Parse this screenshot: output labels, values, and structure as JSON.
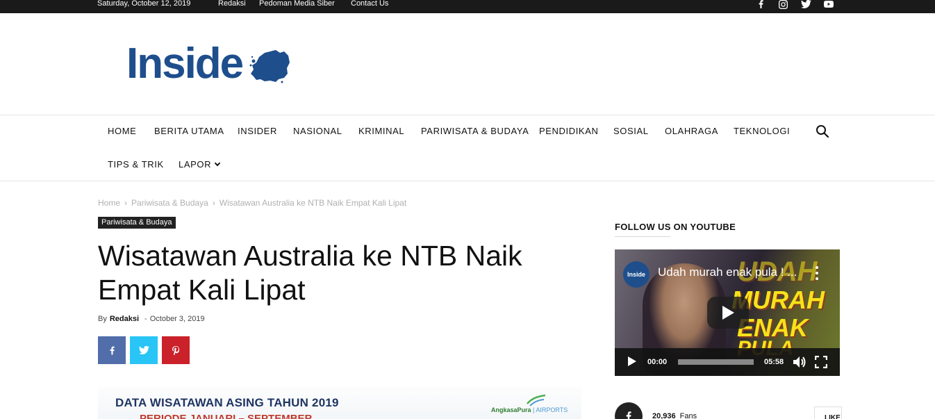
{
  "topbar": {
    "date": "Saturday, October 12, 2019",
    "links": [
      "Redaksi",
      "Pedoman Media Siber",
      "Contact Us"
    ],
    "social_icons": [
      "facebook-icon",
      "instagram-icon",
      "twitter-icon",
      "youtube-icon"
    ]
  },
  "header": {
    "logo_text": "Inside",
    "logo_color": "#1e4e8c"
  },
  "nav": {
    "items": [
      "HOME",
      "BERITA UTAMA",
      "INSIDER",
      "NASIONAL",
      "KRIMINAL",
      "PARIWISATA & BUDAYA",
      "PENDIDIKAN",
      "SOSIAL",
      "OLAHRAGA",
      "TEKNOLOGI",
      "TIPS & TRIK",
      "LAPOR"
    ],
    "search_icon": "search-icon"
  },
  "breadcrumb": {
    "items": [
      "Home",
      "Pariwisata & Budaya",
      "Wisatawan Australia ke NTB Naik Empat Kali Lipat"
    ],
    "separator": "›"
  },
  "article": {
    "category": "Pariwisata & Budaya",
    "title": "Wisatawan Australia ke NTB Naik Empat Kali Lipat",
    "by": "By",
    "author": "Redaksi",
    "dash": "-",
    "date": "October 3, 2019",
    "share": [
      {
        "icon": "facebook-icon",
        "color": "#516eab"
      },
      {
        "icon": "twitter-icon",
        "color": "#29c5f6"
      },
      {
        "icon": "pinterest-icon",
        "color": "#ca212a"
      }
    ],
    "image": {
      "title": "DATA WISATAWAN ASING TAHUN 2019",
      "subtitle": "PERIODE JANUARI – SEPTEMBER",
      "brand": "AngkasaPura",
      "brand_suffix": "| AIRPORTS"
    }
  },
  "sidebar": {
    "title": "FOLLOW US ON YOUTUBE",
    "video": {
      "channel": "Inside",
      "title": "Udah murah enak pula ! ...",
      "overlay_lines": [
        "UDAH",
        "MURAH",
        "ENAK",
        "PULA"
      ],
      "current_time": "00:00",
      "duration": "05:58"
    },
    "fans": {
      "count": "20,936",
      "label": "Fans",
      "like_label": "LIKE"
    }
  }
}
